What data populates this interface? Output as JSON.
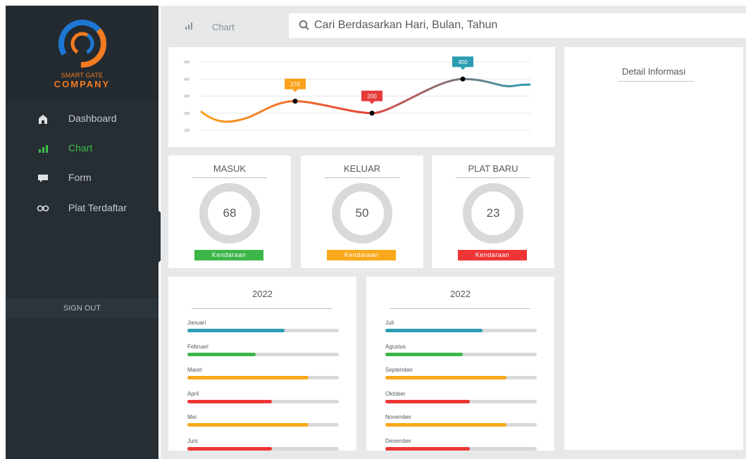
{
  "brand": {
    "line1": "SMART GATE",
    "line2": "COMPANY"
  },
  "sidebar": {
    "items": [
      {
        "label": "Dashboard",
        "icon": "home-icon"
      },
      {
        "label": "Chart",
        "icon": "bar-chart-icon",
        "active": true
      },
      {
        "label": "Form",
        "icon": "message-icon"
      },
      {
        "label": "Plat Terdaftar",
        "icon": "link-icon"
      }
    ],
    "signout_label": "SIGN OUT"
  },
  "header": {
    "title": "Chart",
    "search_placeholder": "Cari Berdasarkan Hari, Bulan, Tahun"
  },
  "chart_data": {
    "type": "line",
    "y_ticks": [
      "100",
      "200",
      "300",
      "400",
      "500"
    ],
    "ylim": [
      100,
      500
    ],
    "points": [
      {
        "value": 270,
        "label": "270",
        "color": "#f9a11b"
      },
      {
        "value": 200,
        "label": "200",
        "color": "#e63a3a"
      },
      {
        "value": 400,
        "label": "400",
        "color": "#2a9db1"
      }
    ],
    "gradient": [
      "#f9a11b",
      "#e6453a",
      "#2a9db1"
    ]
  },
  "stats": [
    {
      "title": "MASUK",
      "value": "68",
      "badge": "Kendaraan",
      "color": "#3cb648"
    },
    {
      "title": "KELUAR",
      "value": "50",
      "badge": "Kendaraan",
      "color": "#f9a81b"
    },
    {
      "title": "PLAT BARU",
      "value": "23",
      "badge": "Kendaraan",
      "color": "#ee3535"
    }
  ],
  "detail": {
    "title": "Detail Informasi"
  },
  "years": [
    {
      "year": "2022",
      "months": [
        {
          "label": "Januari",
          "pct": 0.64,
          "color": "#2a9db1"
        },
        {
          "label": "Februari",
          "pct": 0.45,
          "color": "#3cb648"
        },
        {
          "label": "Maret",
          "pct": 0.8,
          "color": "#f9a81b"
        },
        {
          "label": "April",
          "pct": 0.56,
          "color": "#ee3535"
        },
        {
          "label": "Mei",
          "pct": 0.8,
          "color": "#f9a81b"
        },
        {
          "label": "Juni",
          "pct": 0.56,
          "color": "#ee3535"
        }
      ]
    },
    {
      "year": "2022",
      "months": [
        {
          "label": "Juli",
          "pct": 0.64,
          "color": "#2a9db1"
        },
        {
          "label": "Agustus",
          "pct": 0.51,
          "color": "#3cb648"
        },
        {
          "label": "September",
          "pct": 0.8,
          "color": "#f9a81b"
        },
        {
          "label": "Oktober",
          "pct": 0.56,
          "color": "#ee3535"
        },
        {
          "label": "November",
          "pct": 0.8,
          "color": "#f9a81b"
        },
        {
          "label": "Desember",
          "pct": 0.56,
          "color": "#ee3535"
        }
      ]
    }
  ]
}
